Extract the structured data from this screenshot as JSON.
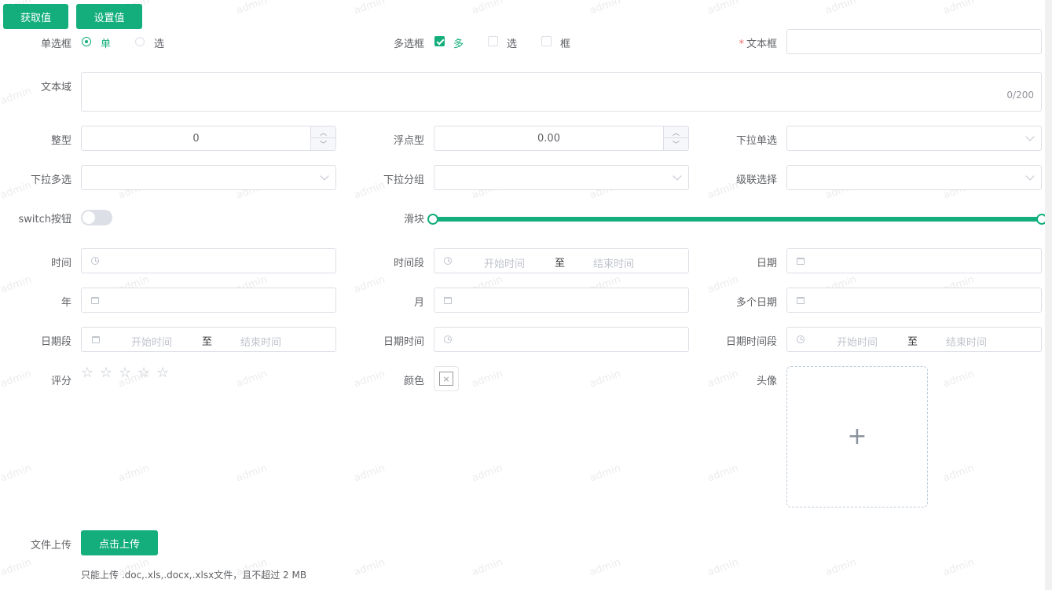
{
  "watermark": "admin",
  "toolbar": {
    "get_value": "获取值",
    "set_value": "设置值"
  },
  "radio": {
    "label": "单选框",
    "options": [
      "单",
      "选"
    ],
    "selected": 0
  },
  "checkbox": {
    "label": "多选框",
    "options": [
      "多",
      "选",
      "框"
    ],
    "checked": [
      0
    ]
  },
  "text_input": {
    "label": "文本框",
    "required_mark": "*",
    "value": ""
  },
  "textarea": {
    "label": "文本域",
    "counter": "0/200"
  },
  "integer": {
    "label": "整型",
    "value": "0"
  },
  "float": {
    "label": "浮点型",
    "value": "0.00"
  },
  "select_single": {
    "label": "下拉单选"
  },
  "select_multi": {
    "label": "下拉多选"
  },
  "select_group": {
    "label": "下拉分组"
  },
  "cascader": {
    "label": "级联选择"
  },
  "switch": {
    "label": "switch按钮",
    "on": false
  },
  "slider": {
    "label": "滑块",
    "range": [
      0,
      1
    ]
  },
  "time": {
    "label": "时间"
  },
  "time_range": {
    "label": "时间段",
    "start_placeholder": "开始时间",
    "separator": "至",
    "end_placeholder": "结束时间"
  },
  "date": {
    "label": "日期"
  },
  "year": {
    "label": "年"
  },
  "month": {
    "label": "月"
  },
  "multi_date": {
    "label": "多个日期"
  },
  "date_range": {
    "label": "日期段",
    "start_placeholder": "开始时间",
    "separator": "至",
    "end_placeholder": "结束时间"
  },
  "datetime": {
    "label": "日期时间"
  },
  "datetime_range": {
    "label": "日期时间段",
    "start_placeholder": "开始时间",
    "separator": "至",
    "end_placeholder": "结束时间"
  },
  "rate": {
    "label": "评分",
    "max": 5,
    "value": 0
  },
  "color": {
    "label": "颜色",
    "empty_glyph": "×"
  },
  "avatar": {
    "label": "头像",
    "plus": "+"
  },
  "file_upload": {
    "label": "文件上传",
    "button": "点击上传",
    "tip": "只能上传 .doc,.xls,.docx,.xlsx文件，且不超过 2 MB"
  },
  "colors": {
    "primary": "#13ae7c",
    "border": "#dcdfe6",
    "placeholder": "#c0c4cc",
    "required": "#f56c6c"
  }
}
